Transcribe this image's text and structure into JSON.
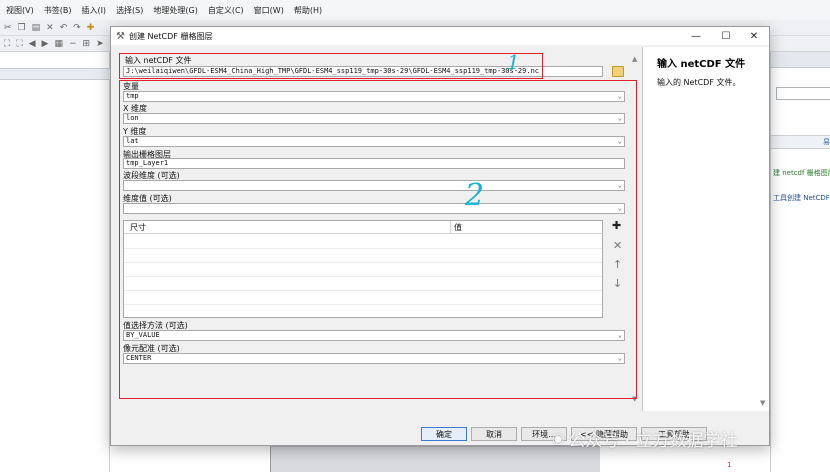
{
  "app": {
    "menu": [
      "视图(V)",
      "书签(B)",
      "插入(I)",
      "选择(S)",
      "地理处理(G)",
      "自定义(C)",
      "窗口(W)",
      "帮助(H)"
    ]
  },
  "right_pane": {
    "text1": "建 netcdf 栅格图层",
    "text2": "工具创建 NetCDF",
    "mark": "易"
  },
  "bottom_mark": "1",
  "dialog": {
    "title": "创建 NetCDF 栅格图层",
    "controls": {
      "minimize": "—",
      "maximize": "☐",
      "close": "✕"
    },
    "input_label": "输入 netCDF 文件",
    "input_value": "J:\\weilaiqiwen\\GFDL-ESM4_China_High_TMP\\GFDL-ESM4_ssp119_tmp-30s-29\\GFDL-ESM4_ssp119_tmp-30s-29.nc",
    "variable_label": "变量",
    "variable_value": "tmp",
    "x_label": "X 维度",
    "x_value": "lon",
    "y_label": "Y 维度",
    "y_value": "lat",
    "output_label": "输出栅格图层",
    "output_value": "tmp_Layer1",
    "band_label": "波段维度 (可选)",
    "band_value": "",
    "dim_label": "维度值 (可选)",
    "dim_value": "",
    "table": {
      "col1": "尺寸",
      "col2": "值"
    },
    "value_method_label": "值选择方法 (可选)",
    "value_method_value": "BY_VALUE",
    "cell_reg_label": "像元配准 (可选)",
    "cell_reg_value": "CENTER",
    "help_title": "输入 netCDF 文件",
    "help_text": "输入的 NetCDF 文件。",
    "buttons": {
      "ok": "确定",
      "cancel": "取消",
      "env": "环境...",
      "hide_help": "<< 隐藏帮助",
      "tool_help": "工具帮助"
    }
  },
  "annotations": {
    "one": "1",
    "two": "2"
  },
  "watermark": "公众号 · 立方数据学社"
}
